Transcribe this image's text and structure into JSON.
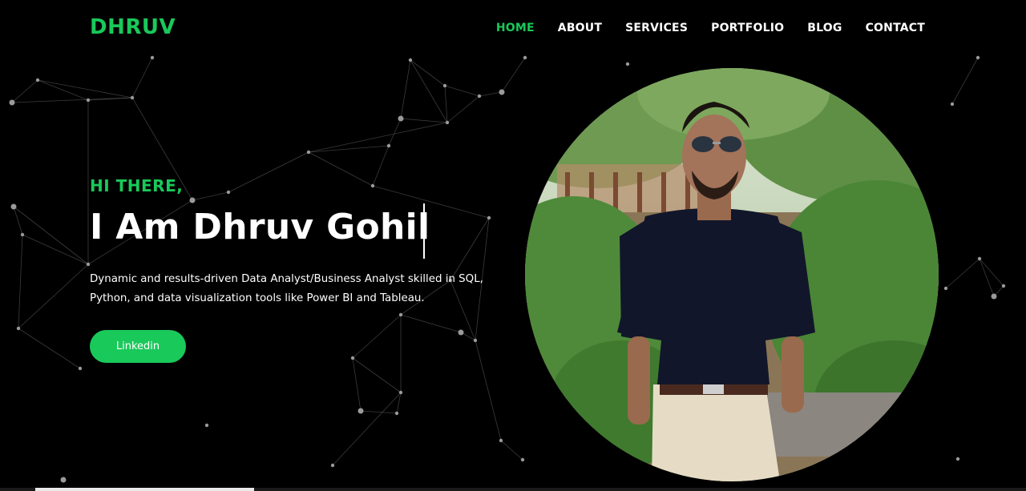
{
  "header": {
    "logo": "DHRUV",
    "nav": [
      {
        "label": "HOME",
        "active": true
      },
      {
        "label": "ABOUT",
        "active": false
      },
      {
        "label": "SERVICES",
        "active": false
      },
      {
        "label": "PORTFOLIO",
        "active": false
      },
      {
        "label": "BLOG",
        "active": false
      },
      {
        "label": "CONTACT",
        "active": false
      }
    ]
  },
  "hero": {
    "greeting": "HI THERE,",
    "headline": "I Am Dhruv Gohil",
    "description": "Dynamic and results-driven Data Analyst/Business Analyst skilled in SQL, Python, and data visualization tools like Power BI and Tableau.",
    "button_label": "Linkedin"
  },
  "colors": {
    "accent": "#19c95a",
    "background": "#000000",
    "text": "#ffffff"
  },
  "icons": {
    "background": "particle-network",
    "portrait": "profile-photo"
  }
}
